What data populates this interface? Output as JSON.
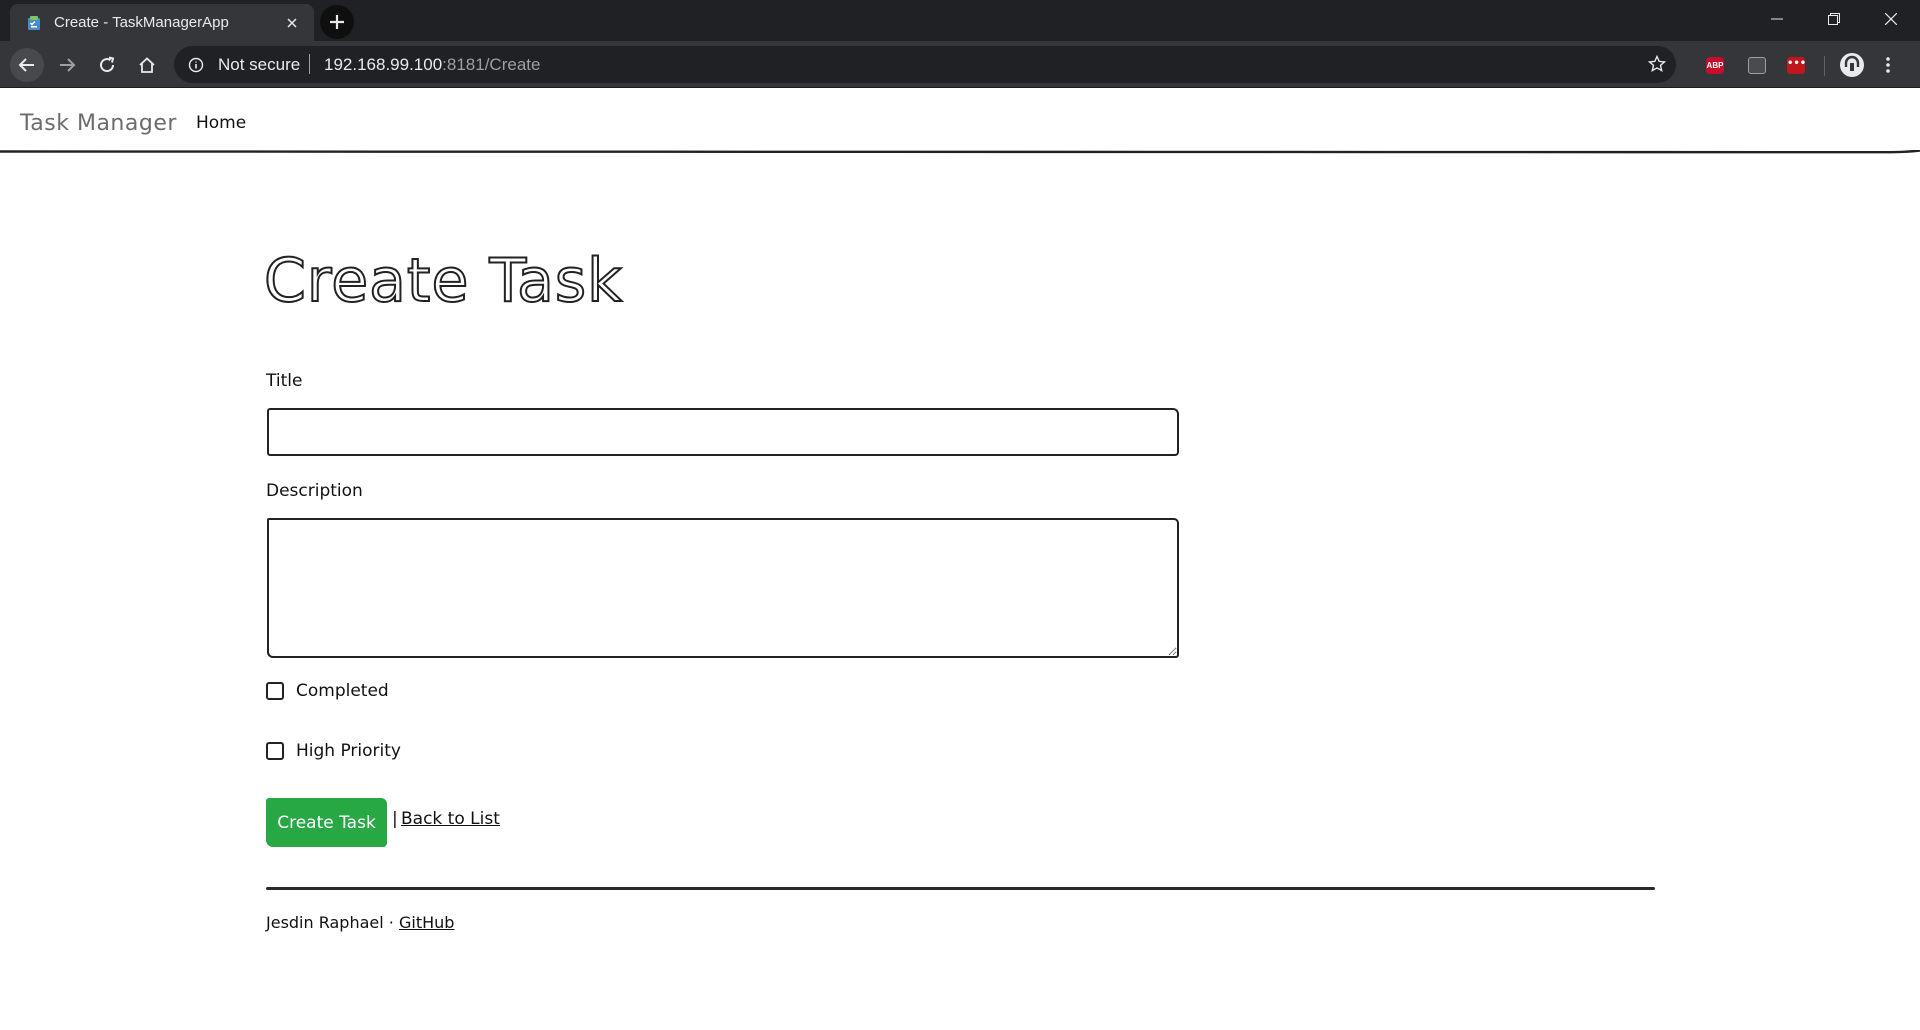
{
  "browser": {
    "tab_title": "Create - TaskManagerApp",
    "security_text": "Not secure",
    "url_host": "192.168.99.100",
    "url_rest": ":8181/Create",
    "extensions": {
      "abp_label": "ABP",
      "dots_label": "•••"
    }
  },
  "nav": {
    "brand": "Task Manager",
    "home": "Home"
  },
  "page": {
    "title": "Create Task",
    "form": {
      "title_label": "Title",
      "title_value": "",
      "description_label": "Description",
      "description_value": "",
      "completed_label": "Completed",
      "high_priority_label": "High Priority",
      "submit_label": "Create Task",
      "separator": "|",
      "back_link": "Back to List"
    }
  },
  "footer": {
    "author": "Jesdin Raphael",
    "bullet": "·",
    "github": "GitHub"
  },
  "colors": {
    "chrome_dark": "#202124",
    "chrome_toolbar": "#35363a",
    "submit_green": "#28a745"
  }
}
